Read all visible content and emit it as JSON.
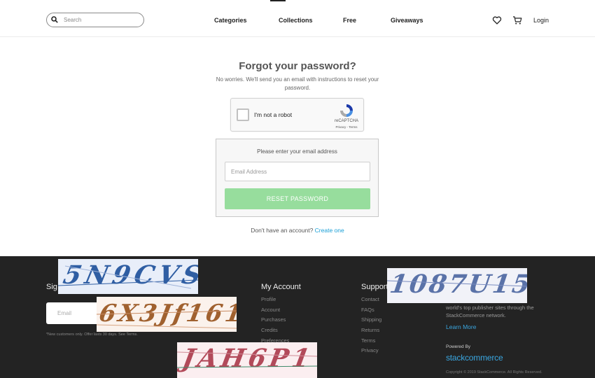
{
  "header": {
    "search_placeholder": "Search",
    "nav": [
      "Categories",
      "Collections",
      "Free",
      "Giveaways"
    ],
    "login": "Login",
    "icons": [
      "search-icon",
      "heart-icon",
      "cart-icon"
    ]
  },
  "main": {
    "title": "Forgot your password?",
    "subtitle": "No worries. We'll send you an email with instructions to reset your password.",
    "captcha": {
      "label": "I'm not a robot",
      "brand": "reCAPTCHA",
      "terms": "Privacy - Terms"
    },
    "form_label": "Please enter your email address",
    "email_placeholder": "Email Address",
    "reset_label": "RESET PASSWORD",
    "no_account": "Don't have an account?",
    "create_link": "Create one"
  },
  "footer": {
    "signup_heading": "Sig",
    "email_placeholder": "Email",
    "note": "*New customers only. Offer lasts 30 days. See Terms.",
    "my_account": {
      "heading": "My Account",
      "links": [
        "Profile",
        "Account",
        "Purchases",
        "Credits",
        "Preferences"
      ]
    },
    "support": {
      "heading": "Support",
      "links": [
        "Contact",
        "FAQs",
        "Shipping",
        "Returns",
        "Terms",
        "Privacy"
      ]
    },
    "about_text": "world's top publisher sites through the StackCommerce network.",
    "learn_more": "Learn More",
    "powered_by": "Powered By",
    "brand": "stackcommerce",
    "copyright": "Copyright © 2019 StackCommerce. All Rights Reserved."
  },
  "captcha_overlays": [
    {
      "text": "5N9CVS",
      "color": "#2f5ea3",
      "bg": "#e8eef9"
    },
    {
      "text": "6X3Jf161",
      "color": "#a0612f",
      "bg": "#fbf2ec"
    },
    {
      "text": "1087U15",
      "color": "#5a72a8",
      "bg": "#f1f2f8"
    },
    {
      "text": "JAH6P1",
      "color": "#b24a5a",
      "bg": "#fbeef0"
    }
  ],
  "colors": {
    "accent": "#1a9fd6",
    "button": "#97dd9d",
    "footer_bg": "#232323"
  }
}
